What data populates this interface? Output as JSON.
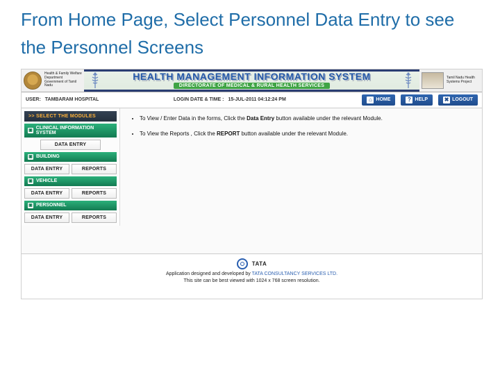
{
  "slide": {
    "title": "From Home Page, Select Personnel Data Entry to see the Personnel Screens"
  },
  "banner": {
    "title": "HEALTH MANAGEMENT INFORMATION SYSTEM",
    "subtitle": "DIRECTORATE OF MEDICAL & RURAL HEALTH SERVICES",
    "left_caption": "Health & Family Welfare Department Government of Tamil Nadu",
    "right_caption": "Tamil Nadu Health Systems Project"
  },
  "infobar": {
    "user_label": "USER:",
    "user_value": "TAMBARAM HOSPITAL",
    "login_label": "LOGIN DATE & TIME :",
    "login_value": "15-JUL-2011 04:12:24 PM"
  },
  "top_buttons": {
    "home": "HOME",
    "help": "HELP",
    "logout": "LOGOUT"
  },
  "sidebar": {
    "header": ">> SELECT THE MODULES",
    "modules": [
      {
        "name": "CLINICAL INFORMATION SYSTEM",
        "actions": [
          "DATA ENTRY"
        ],
        "single": true
      },
      {
        "name": "BUILDING",
        "actions": [
          "DATA ENTRY",
          "REPORTS"
        ]
      },
      {
        "name": "VEHICLE",
        "actions": [
          "DATA ENTRY",
          "REPORTS"
        ]
      },
      {
        "name": "PERSONNEL",
        "actions": [
          "DATA ENTRY",
          "REPORTS"
        ]
      }
    ]
  },
  "instructions": {
    "line1_a": "To View / Enter Data in the forms, Click the ",
    "line1_b": "Data Entry",
    "line1_c": " button available under the relevant Module.",
    "line2_a": "To View the Reports , Click the ",
    "line2_b": "REPORT",
    "line2_c": " button available under the relevant Module."
  },
  "footer": {
    "brand": "TATA",
    "line1_a": "Application designed and developed by ",
    "line1_b": "TATA CONSULTANCY SERVICES LTD.",
    "line2": "This site can be best viewed with 1024 x 768 screen resolution."
  },
  "icons": {
    "home": "⌂",
    "help": "?",
    "logout": "✖",
    "module": "▣"
  }
}
